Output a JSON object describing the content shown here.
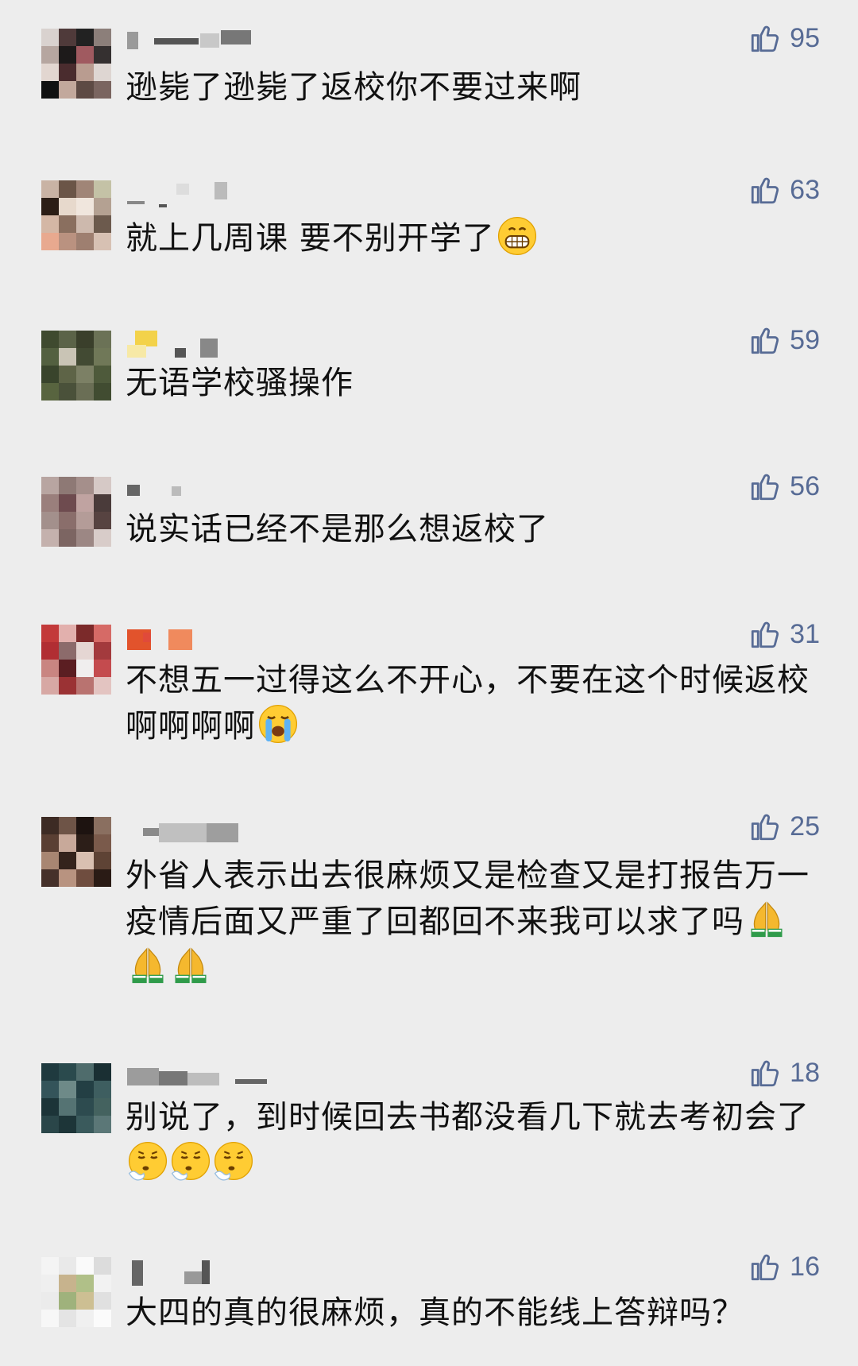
{
  "comments": [
    {
      "likes": "95",
      "text": "逊毙了逊毙了返校你不要过来啊",
      "emojis": [],
      "avatar_colors": [
        "#d9d2cf",
        "#4f3a3a",
        "#222",
        "#8c7f7a",
        "#b6a6a0",
        "#1d1a1a",
        "#a05a60",
        "#353030",
        "#e2d6d0",
        "#4a2c2e",
        "#b99c90",
        "#ded6d2",
        "#111",
        "#c2a89c",
        "#5d4a44",
        "#7a6560"
      ],
      "name_colors": [
        "#9a9a9a",
        "#555",
        "#c8c8c8",
        "#777"
      ]
    },
    {
      "likes": "63",
      "text": "就上几周课 要不别开学了",
      "emojis": [
        "grin"
      ],
      "avatar_colors": [
        "#c9b3a4",
        "#6b5547",
        "#a08577",
        "#c4c2a6",
        "#2c1e16",
        "#e7d9cc",
        "#f0e6dd",
        "#b4a192",
        "#d4b7a5",
        "#8a6f5f",
        "#cdb9ad",
        "#6c5a4d",
        "#e8a98f",
        "#ba9280",
        "#9e7f70",
        "#d7c1b3"
      ],
      "name_colors": [
        "#888",
        "#ddd",
        "#bbb",
        "#555"
      ]
    },
    {
      "likes": "59",
      "text": "无语学校骚操作",
      "emojis": [],
      "avatar_colors": [
        "#3f4a2f",
        "#5b6348",
        "#3a3f2b",
        "#6b7256",
        "#536040",
        "#c9c4b5",
        "#424a33",
        "#707858",
        "#39442c",
        "#5e6447",
        "#7c8065",
        "#4e5a3b",
        "#58643f",
        "#4a513a",
        "#6a6e55",
        "#414c31"
      ],
      "name_colors": [
        "#f3d24a",
        "#f7e9a6",
        "#555",
        "#888"
      ]
    },
    {
      "likes": "56",
      "text": "说实话已经不是那么想返校了",
      "emojis": [],
      "avatar_colors": [
        "#b8a5a1",
        "#8e7975",
        "#a58f8b",
        "#d6c9c6",
        "#9a7f7c",
        "#6e4b4f",
        "#c0a3a1",
        "#4a3b3a",
        "#a3908c",
        "#8a6e6b",
        "#b49c98",
        "#574341",
        "#c4b1ad",
        "#7c6562",
        "#9c8784",
        "#d8ccc9"
      ],
      "name_colors": [
        "#666",
        "#bbb"
      ]
    },
    {
      "likes": "31",
      "text": "不想五一过得这么不开心，不要在这个时候返校啊啊啊啊",
      "emojis": [
        "cry"
      ],
      "avatar_colors": [
        "#c33a3a",
        "#e2b0ad",
        "#7b2a2a",
        "#d66a66",
        "#b12e33",
        "#8c6b6b",
        "#e5d6d3",
        "#a33a3d",
        "#c98581",
        "#5b1e22",
        "#f0eeee",
        "#c44b4e",
        "#d7a8a4",
        "#9b3234",
        "#b97370",
        "#e3c4c1"
      ],
      "name_colors": [
        "#e2532c",
        "#f08a5d",
        "#e04a3a",
        "#f3b09a"
      ]
    },
    {
      "likes": "25",
      "text": "外省人表示出去很麻烦又是检查又是打报告万一疫情后面又严重了回都回不来我可以求了吗",
      "emojis": [
        "pray",
        "pray",
        "pray"
      ],
      "avatar_colors": [
        "#3d2b24",
        "#6e5447",
        "#1d1310",
        "#8a6f60",
        "#5a3f33",
        "#c8a99a",
        "#2c1e18",
        "#7a5a4b",
        "#a88672",
        "#34231c",
        "#d9c0b1",
        "#5e4335",
        "#45302a",
        "#b89380",
        "#6f4d3f",
        "#2a1b15"
      ],
      "name_colors": [
        "#c0c0c0",
        "#9e9e9e",
        "#8a8a8a",
        "#d4d4d4"
      ]
    },
    {
      "likes": "18",
      "text": "别说了，到时候回去书都没看几下就去考初会了",
      "emojis": [
        "tired",
        "tired",
        "tired"
      ],
      "avatar_colors": [
        "#1f3a3f",
        "#2a4a4d",
        "#4f6c6c",
        "#1a2f33",
        "#34545a",
        "#6e8a88",
        "#233f44",
        "#3e5e60",
        "#1c3438",
        "#557373",
        "#2d4b4f",
        "#44625f",
        "#2a4649",
        "#1d3538",
        "#3a5a5c",
        "#5b7777"
      ],
      "name_colors": [
        "#9c9c9c",
        "#777",
        "#bdbdbd",
        "#666"
      ]
    },
    {
      "likes": "16",
      "text": "大四的真的很麻烦，真的不能线上答辩吗？",
      "emojis": [],
      "avatar_colors": [
        "#f4f4f4",
        "#e9e9e9",
        "#fafafa",
        "#dcdcdc",
        "#efefef",
        "#c7b38d",
        "#b0c088",
        "#f2f2f2",
        "#ebebeb",
        "#9fb27c",
        "#cdbf93",
        "#e0e0e0",
        "#f7f7f7",
        "#e4e4e4",
        "#f0f0f0",
        "#fbfbfb"
      ],
      "name_colors": [
        "#666",
        "#999",
        "#555"
      ]
    }
  ],
  "icons": {
    "like": "thumbs-up-icon",
    "emoji_grin": "grinning-face-icon",
    "emoji_cry": "loudly-crying-face-icon",
    "emoji_pray": "folded-hands-icon",
    "emoji_tired": "face-exhaling-icon"
  },
  "colors": {
    "background": "#ededed",
    "like_color": "#576b95",
    "text_color": "#111111"
  }
}
